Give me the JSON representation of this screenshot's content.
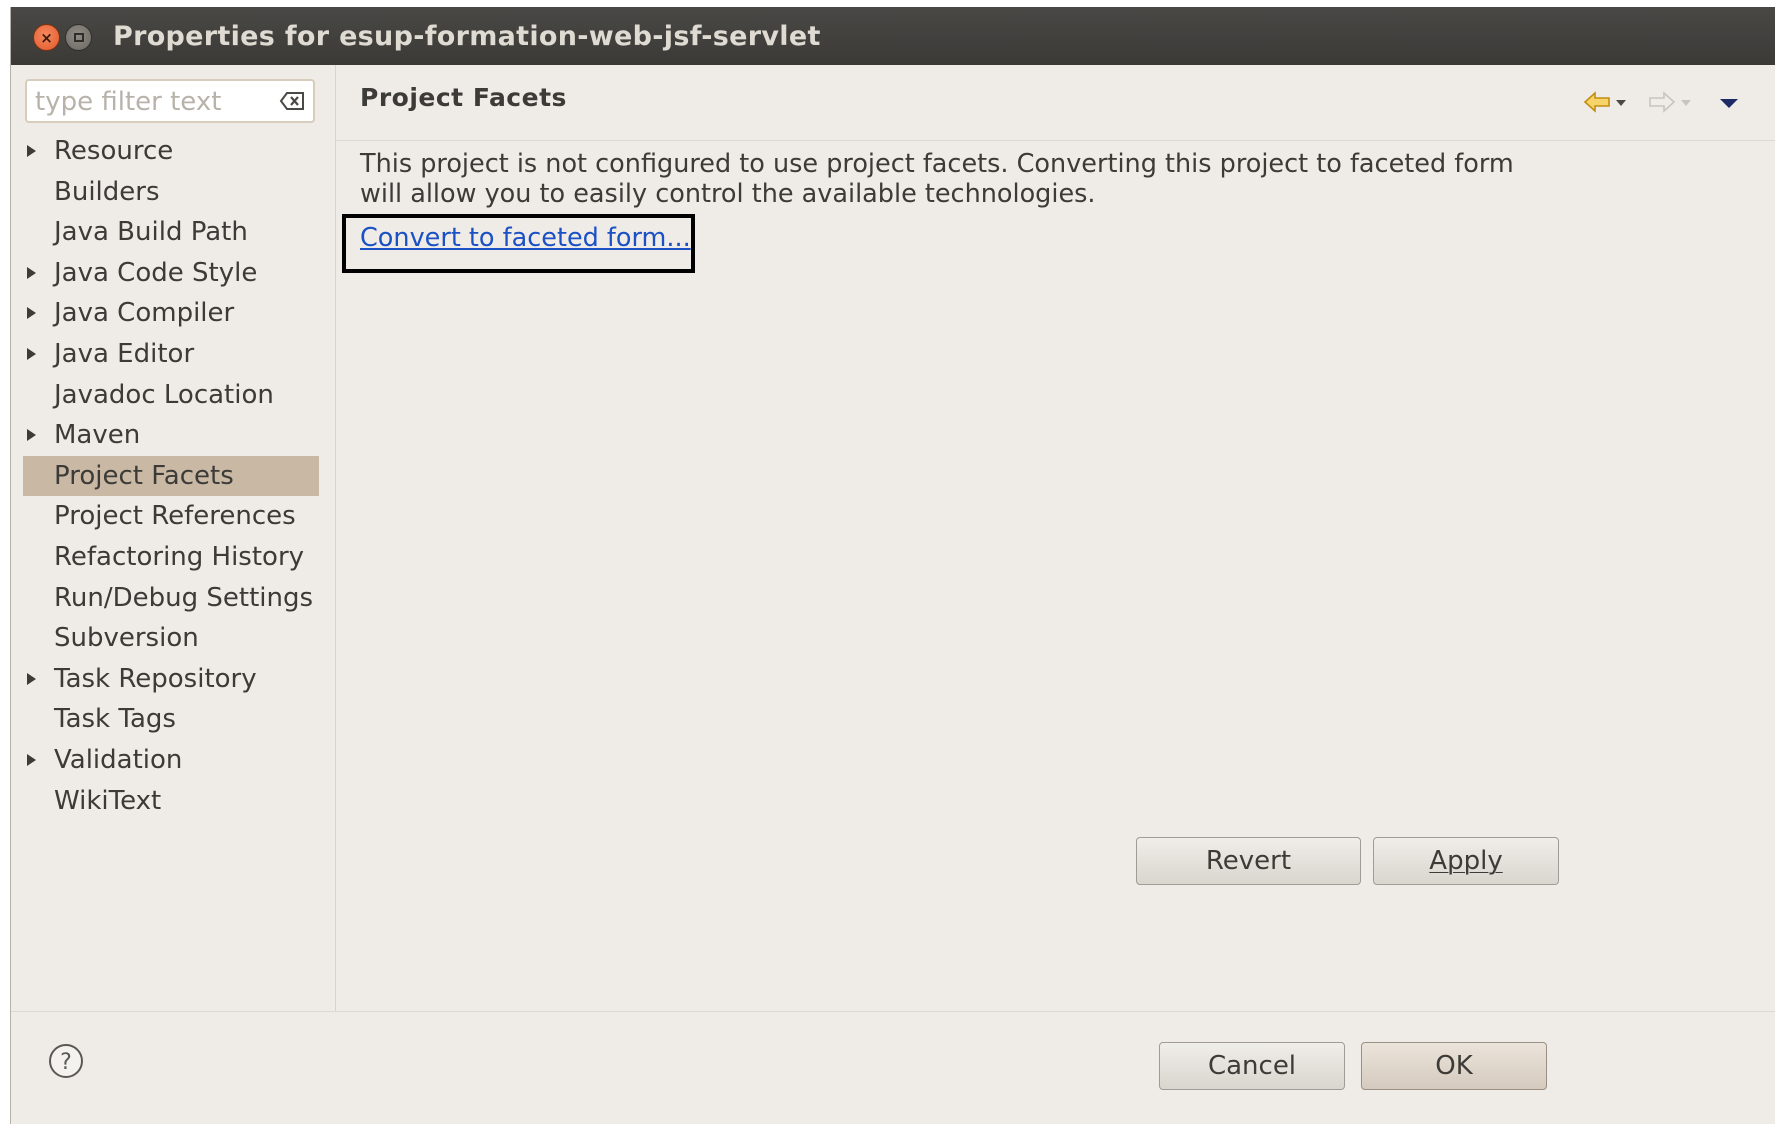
{
  "window": {
    "title": "Properties for esup-formation-web-jsf-servlet"
  },
  "filter": {
    "placeholder": "type filter text"
  },
  "tree": {
    "items": [
      {
        "label": "Resource",
        "expandable": true,
        "selected": false
      },
      {
        "label": "Builders",
        "expandable": false,
        "selected": false
      },
      {
        "label": "Java Build Path",
        "expandable": false,
        "selected": false
      },
      {
        "label": "Java Code Style",
        "expandable": true,
        "selected": false
      },
      {
        "label": "Java Compiler",
        "expandable": true,
        "selected": false
      },
      {
        "label": "Java Editor",
        "expandable": true,
        "selected": false
      },
      {
        "label": "Javadoc Location",
        "expandable": false,
        "selected": false
      },
      {
        "label": "Maven",
        "expandable": true,
        "selected": false
      },
      {
        "label": "Project Facets",
        "expandable": false,
        "selected": true
      },
      {
        "label": "Project References",
        "expandable": false,
        "selected": false
      },
      {
        "label": "Refactoring History",
        "expandable": false,
        "selected": false
      },
      {
        "label": "Run/Debug Settings",
        "expandable": false,
        "selected": false
      },
      {
        "label": "Subversion",
        "expandable": false,
        "selected": false
      },
      {
        "label": "Task Repository",
        "expandable": true,
        "selected": false
      },
      {
        "label": "Task Tags",
        "expandable": false,
        "selected": false
      },
      {
        "label": "Validation",
        "expandable": true,
        "selected": false
      },
      {
        "label": "WikiText",
        "expandable": false,
        "selected": false
      }
    ]
  },
  "page": {
    "title": "Project Facets",
    "description": "This project is not configured to use project facets. Converting this project to faceted form will allow you to easily control the available technologies.",
    "convert_link": "Convert to faceted form..."
  },
  "buttons": {
    "revert": "Revert",
    "apply": "Apply",
    "cancel": "Cancel",
    "ok": "OK"
  },
  "icons": {
    "back": "back-arrow-icon",
    "forward": "forward-arrow-icon",
    "menu": "view-menu-icon",
    "help": "help-icon",
    "clear": "clear-filter-icon"
  },
  "colors": {
    "selection": "#c9b8a4",
    "link": "#1b51c5",
    "back_arrow": "#e8b020"
  }
}
